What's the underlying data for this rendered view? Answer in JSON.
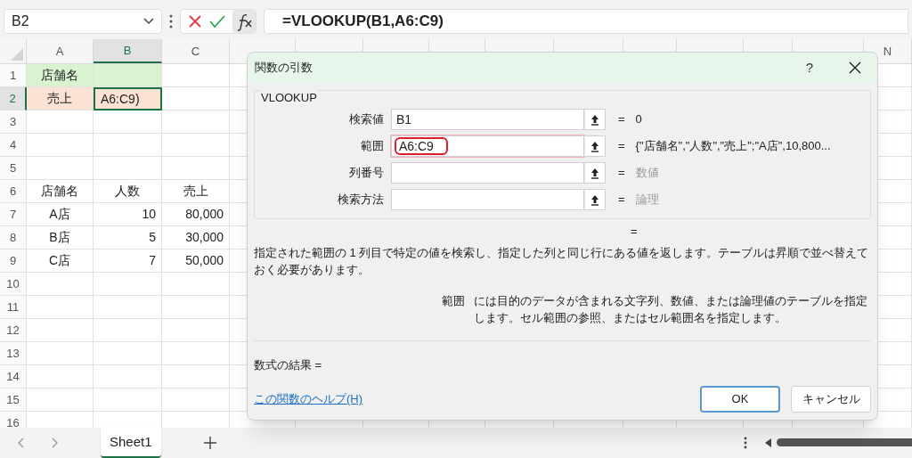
{
  "name_box": "B2",
  "formula": "=VLOOKUP(B1,A6:C9)",
  "columns": [
    {
      "label": "A",
      "selected": false
    },
    {
      "label": "B",
      "selected": true
    },
    {
      "label": "C",
      "selected": false
    },
    {
      "label": "N",
      "selected": false
    }
  ],
  "rows": [
    {
      "label": "1",
      "selected": false,
      "cells": [
        {
          "text": "店舗名",
          "kind": "label",
          "color": "#d9f2d0",
          "selected": false
        },
        {
          "color": "#d9f2d0",
          "selected": false
        },
        {
          "selected": false
        }
      ]
    },
    {
      "label": "2",
      "selected": true,
      "cells": [
        {
          "text": "売上",
          "kind": "label",
          "color": "#fbe2d5",
          "selected": false
        },
        {
          "text": "A6:C9)",
          "kind": "editing",
          "color": "#fbe2d5",
          "selected": true
        },
        {
          "selected": false
        }
      ]
    },
    {
      "label": "3",
      "selected": false,
      "cells": []
    },
    {
      "label": "4",
      "selected": false,
      "cells": []
    },
    {
      "label": "5",
      "selected": false,
      "cells": []
    },
    {
      "label": "6",
      "selected": false,
      "cells": [
        {
          "text": "店舗名",
          "kind": "label",
          "selected": false
        },
        {
          "text": "人数",
          "kind": "label",
          "selected": false
        },
        {
          "text": "売上",
          "kind": "label",
          "selected": false
        }
      ]
    },
    {
      "label": "7",
      "selected": false,
      "cells": [
        {
          "text": "A店",
          "kind": "label",
          "selected": false
        },
        {
          "text": "10",
          "kind": "number",
          "selected": false
        },
        {
          "text": "80,000",
          "kind": "number",
          "selected": false
        }
      ]
    },
    {
      "label": "8",
      "selected": false,
      "cells": [
        {
          "text": "B店",
          "kind": "label",
          "selected": false
        },
        {
          "text": "5",
          "kind": "number",
          "selected": false
        },
        {
          "text": "30,000",
          "kind": "number",
          "selected": false
        }
      ]
    },
    {
      "label": "9",
      "selected": false,
      "cells": [
        {
          "text": "C店",
          "kind": "label",
          "selected": false
        },
        {
          "text": "7",
          "kind": "number",
          "selected": false
        },
        {
          "text": "50,000",
          "kind": "number",
          "selected": false
        }
      ]
    },
    {
      "label": "10",
      "selected": false,
      "cells": []
    },
    {
      "label": "11",
      "selected": false,
      "cells": []
    },
    {
      "label": "12",
      "selected": false,
      "cells": []
    },
    {
      "label": "13",
      "selected": false,
      "cells": []
    },
    {
      "label": "14",
      "selected": false,
      "cells": []
    },
    {
      "label": "15",
      "selected": false,
      "cells": []
    },
    {
      "label": "16",
      "selected": false,
      "cells": []
    }
  ],
  "sheet_tabs": [
    {
      "label": "Sheet1",
      "selected": true
    }
  ],
  "dialog": {
    "title": "関数の引数",
    "help": "?",
    "function_name": "VLOOKUP",
    "arguments": [
      {
        "label": "検索値",
        "value": "B1",
        "result": "0",
        "kind": "value",
        "highlighted": false
      },
      {
        "label": "範囲",
        "value": "A6:C9",
        "result": "{\"店舗名\",\"人数\",\"売上\";\"A店\",10,800...",
        "kind": "value",
        "highlighted": true
      },
      {
        "label": "列番号",
        "result": "数値",
        "kind": "type",
        "highlighted": false
      },
      {
        "label": "検索方法",
        "result": "論理",
        "kind": "type",
        "highlighted": false
      }
    ],
    "function_result": "=",
    "description": "指定された範囲の 1 列目で特定の値を検索し、指定した列と同じ行にある値を返します。テーブルは昇順で並べ替えておく必要があります。",
    "argument_help": {
      "name": "範囲",
      "text": "には目的のデータが含まれる文字列、数値、または論理値のテーブルを指定します。セル範囲の参照、またはセル範囲名を指定します。"
    },
    "formula_result": "数式の結果 =",
    "help_link": "この関数のヘルプ(H)",
    "buttons": [
      {
        "label": "OK",
        "default": true
      },
      {
        "label": "キャンセル",
        "default": false
      }
    ]
  }
}
